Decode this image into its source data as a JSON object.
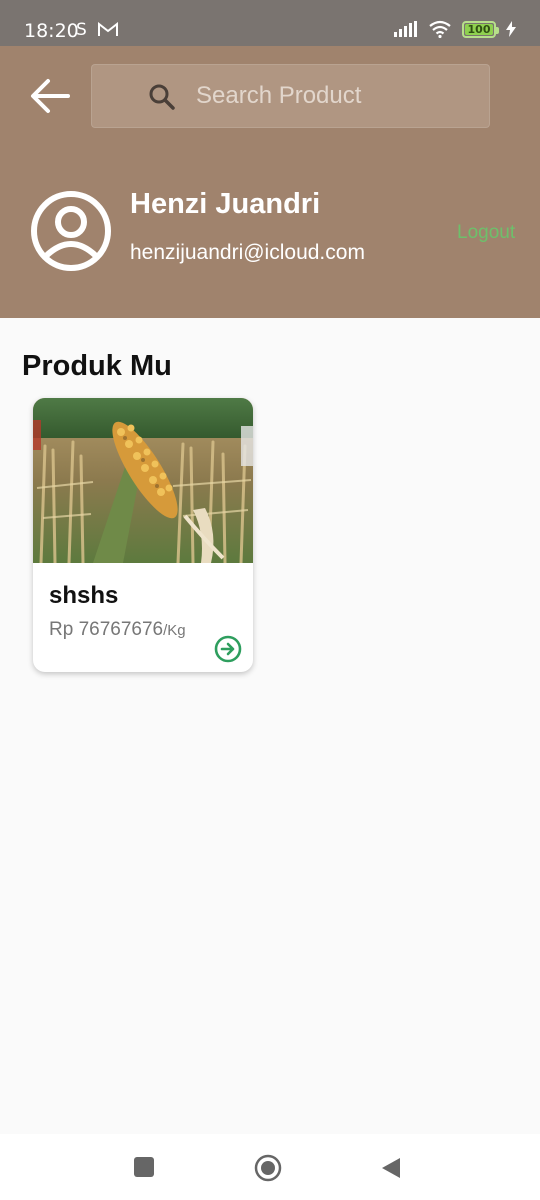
{
  "status_bar": {
    "time": "18:20",
    "left_icons": [
      "sync-icon",
      "gmail-icon"
    ],
    "right_icons": [
      "signal-icon",
      "wifi-icon",
      "battery-icon",
      "charging-icon"
    ],
    "battery_level": "100"
  },
  "header": {
    "background_color": "#a0836d",
    "search": {
      "placeholder": "Search Product",
      "value": ""
    },
    "user": {
      "name": "Henzi Juandri",
      "email": "henzijuandri@icloud.com"
    },
    "logout_label": "Logout",
    "logout_color": "#6dc06b"
  },
  "main": {
    "section_title": "Produk Mu",
    "products": [
      {
        "name": "shshs",
        "currency": "Rp",
        "price": "76767676",
        "unit": "/Kg",
        "image": "corn-cob-field-photo"
      }
    ]
  },
  "nav_bar": {
    "buttons": [
      "recents-icon",
      "home-icon",
      "back-icon"
    ]
  }
}
